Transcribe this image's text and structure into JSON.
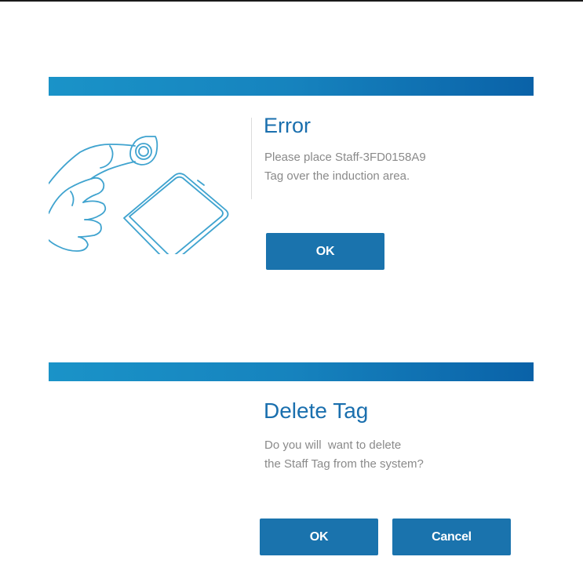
{
  "colors": {
    "title_bar_start": "#1a93c8",
    "title_bar_end": "#0a62a8",
    "title_text": "#1a6fae",
    "message_text": "#8a8a8a",
    "button_bg": "#1a73ad",
    "button_text": "#ffffff",
    "illustration_stroke": "#3fa3cf"
  },
  "error_dialog": {
    "title": "Error",
    "message_line1": "Please place Staff-3FD0158A9",
    "message_line2": "Tag over the induction area.",
    "ok_label": "OK",
    "illustration_icon": "hand-tapping-tag-on-reader-icon"
  },
  "delete_dialog": {
    "title": "Delete Tag",
    "message_line1": "Do you will  want to delete",
    "message_line2": "the Staff Tag from the system?",
    "ok_label": "OK",
    "cancel_label": "Cancel"
  }
}
